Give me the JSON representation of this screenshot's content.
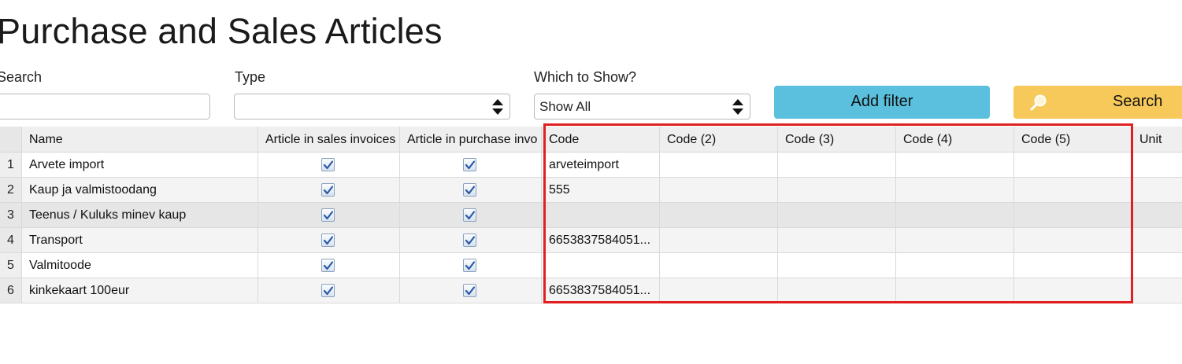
{
  "page": {
    "title": "Purchase and Sales Articles"
  },
  "filters": {
    "search_label": "Search",
    "search_value": "",
    "type_label": "Type",
    "type_value": "",
    "which_label": "Which to Show?",
    "which_value": "Show All",
    "add_filter_label": "Add filter",
    "search_button_label": "Search"
  },
  "table": {
    "columns": [
      "Name",
      "Article in sales invoices",
      "Article in purchase invo",
      "Code",
      "Code (2)",
      "Code (3)",
      "Code (4)",
      "Code (5)",
      "Unit"
    ],
    "rows": [
      {
        "num": "1",
        "name": "Arvete import",
        "sales": true,
        "purchase": true,
        "code": "arveteimport",
        "code2": "",
        "code3": "",
        "code4": "",
        "code5": "",
        "unit": ""
      },
      {
        "num": "2",
        "name": "Kaup ja valmistoodang",
        "sales": true,
        "purchase": true,
        "code": "555",
        "code2": "",
        "code3": "",
        "code4": "",
        "code5": "",
        "unit": ""
      },
      {
        "num": "3",
        "name": "Teenus / Kuluks minev kaup",
        "sales": true,
        "purchase": true,
        "code": "",
        "code2": "",
        "code3": "",
        "code4": "",
        "code5": "",
        "unit": ""
      },
      {
        "num": "4",
        "name": "Transport",
        "sales": true,
        "purchase": true,
        "code": "6653837584051...",
        "code2": "",
        "code3": "",
        "code4": "",
        "code5": "",
        "unit": ""
      },
      {
        "num": "5",
        "name": "Valmitoode",
        "sales": true,
        "purchase": true,
        "code": "",
        "code2": "",
        "code3": "",
        "code4": "",
        "code5": "",
        "unit": ""
      },
      {
        "num": "6",
        "name": "kinkekaart 100eur",
        "sales": true,
        "purchase": true,
        "code": "6653837584051...",
        "code2": "",
        "code3": "",
        "code4": "",
        "code5": "",
        "unit": ""
      }
    ]
  },
  "colors": {
    "add_filter_bg": "#5bc0de",
    "search_bg": "#f7c95a",
    "highlight": "#e02020"
  },
  "icons": {
    "search": "magnifier-icon",
    "select": "updown-arrows-icon",
    "check": "checkmark-icon"
  }
}
